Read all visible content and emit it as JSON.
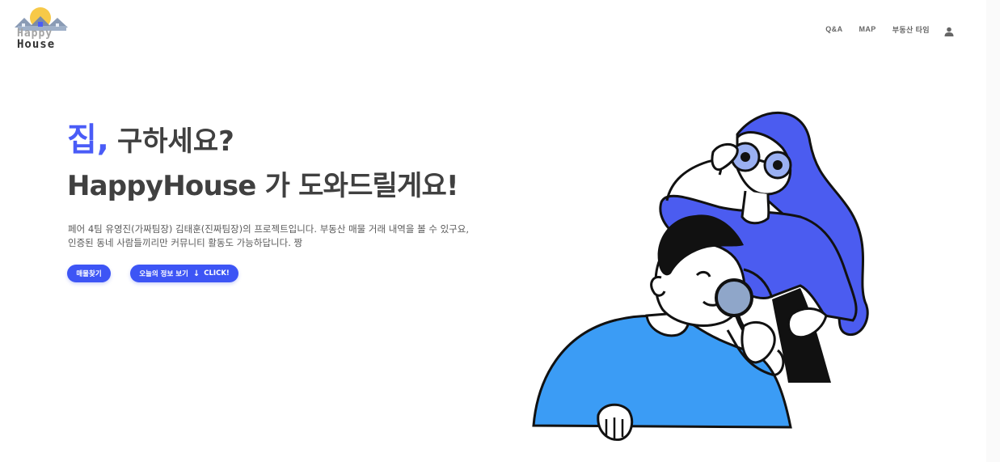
{
  "header": {
    "logo": {
      "text_line1": "Happy",
      "text_line2": "House",
      "sun_color": "#f7c948",
      "roof_color": "#8a9bb5"
    },
    "nav": [
      {
        "label": "Q&A"
      },
      {
        "label": "MAP"
      },
      {
        "label": "부동산 타임"
      }
    ],
    "user_icon": "user-icon"
  },
  "hero": {
    "title_accent": "집,",
    "title_rest": "구하세요?",
    "subtitle": "HappyHouse 가 도와드릴게요!",
    "description_line1": "페어 4팀 유영진(가짜팀장) 김태훈(진짜팀장)의 프로젝트입니다. 부동산 매물 거래 내역을 볼 수 있구요,",
    "description_line2": "인증된 동네 사람들끼리만 커뮤니티 활동도 가능하답니다. 짱",
    "buttons": {
      "find_label": "매물찾기",
      "info_label": "오늘의 정보 보기",
      "info_arrow": "↓",
      "info_suffix": "CLICK!"
    }
  },
  "colors": {
    "accent": "#4a5cf7",
    "button": "#3d55f5",
    "woman": "#4b5cf0",
    "man_shirt": "#3b9cf5"
  }
}
